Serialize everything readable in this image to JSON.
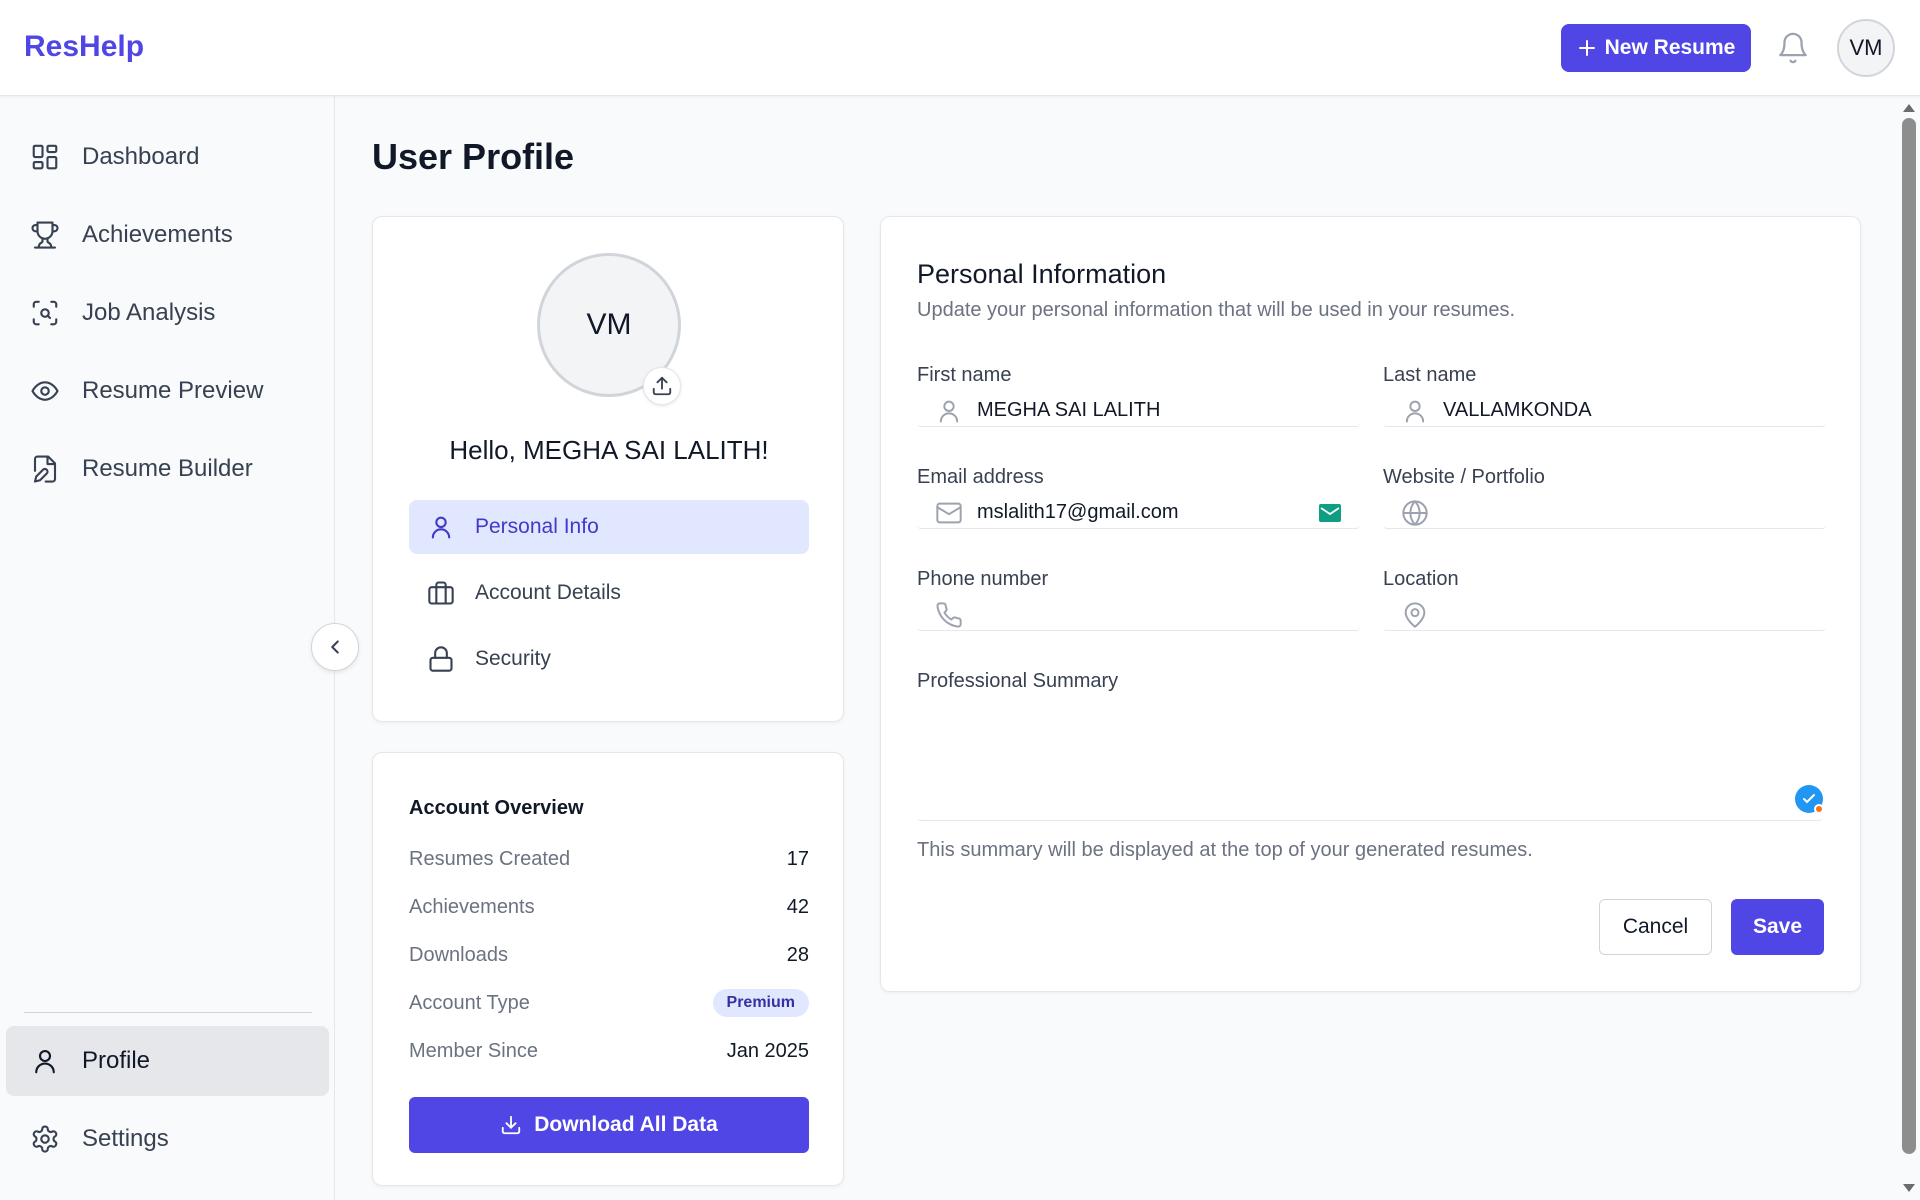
{
  "app": {
    "brand": "ResHelp"
  },
  "header": {
    "new_resume_label": "New Resume",
    "avatar_initials": "VM"
  },
  "sidebar": {
    "items": [
      {
        "label": "Dashboard",
        "icon": "dashboard-icon"
      },
      {
        "label": "Achievements",
        "icon": "trophy-icon"
      },
      {
        "label": "Job Analysis",
        "icon": "scan-search-icon"
      },
      {
        "label": "Resume Preview",
        "icon": "eye-icon"
      },
      {
        "label": "Resume Builder",
        "icon": "file-edit-icon"
      }
    ],
    "bottom_items": [
      {
        "label": "Profile",
        "icon": "user-icon",
        "active": true
      },
      {
        "label": "Settings",
        "icon": "gear-icon"
      }
    ]
  },
  "page": {
    "title": "User Profile"
  },
  "profile_card": {
    "avatar_initials": "VM",
    "greeting": "Hello, MEGHA SAI LALITH!",
    "tabs": [
      {
        "label": "Personal Info",
        "icon": "user-icon",
        "active": true
      },
      {
        "label": "Account Details",
        "icon": "briefcase-icon"
      },
      {
        "label": "Security",
        "icon": "lock-icon"
      }
    ]
  },
  "overview": {
    "title": "Account Overview",
    "rows": [
      {
        "label": "Resumes Created",
        "value": "17"
      },
      {
        "label": "Achievements",
        "value": "42"
      },
      {
        "label": "Downloads",
        "value": "28"
      },
      {
        "label": "Account Type",
        "value": "Premium"
      },
      {
        "label": "Member Since",
        "value": "Jan 2025"
      }
    ],
    "download_label": "Download All Data"
  },
  "personal_info": {
    "title": "Personal Information",
    "description": "Update your personal information that will be used in your resumes.",
    "fields": {
      "first_name": {
        "label": "First name",
        "value": "MEGHA SAI LALITH"
      },
      "last_name": {
        "label": "Last name",
        "value": "VALLAMKONDA"
      },
      "email": {
        "label": "Email address",
        "value": "mslalith17@gmail.com"
      },
      "website": {
        "label": "Website / Portfolio",
        "value": ""
      },
      "phone": {
        "label": "Phone number",
        "value": ""
      },
      "location": {
        "label": "Location",
        "value": ""
      },
      "summary": {
        "label": "Professional Summary",
        "value": ""
      }
    },
    "summary_hint": "This summary will be displayed at the top of your generated resumes.",
    "cancel_label": "Cancel",
    "save_label": "Save"
  },
  "colors": {
    "accent": "#4f46e5",
    "accent_light": "#e0e7ff",
    "text": "#111827",
    "muted": "#6b7280"
  }
}
